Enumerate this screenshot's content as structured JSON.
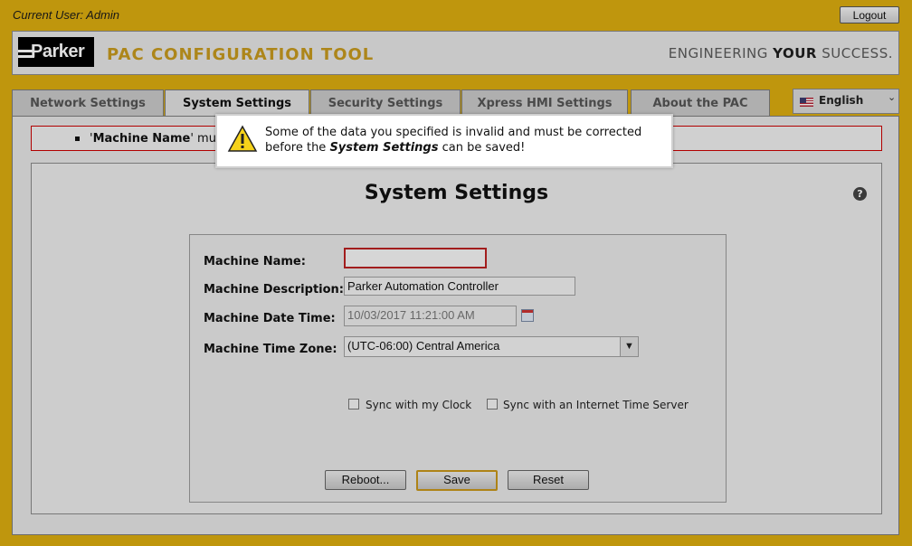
{
  "header": {
    "current_user": "Current User: Admin",
    "logout_label": "Logout",
    "app_title": "PAC CONFIGURATION TOOL",
    "logo_text": "Parker",
    "tagline_pre": "ENGINEERING ",
    "tagline_bold": "YOUR",
    "tagline_post": " SUCCESS."
  },
  "tabs": [
    {
      "label": "Network Settings",
      "active": false
    },
    {
      "label": "System Settings",
      "active": true
    },
    {
      "label": "Security Settings",
      "active": false
    },
    {
      "label": "Xpress HMI Settings",
      "active": false
    },
    {
      "label": "About the PAC",
      "active": false
    }
  ],
  "language": {
    "label": "English"
  },
  "error": {
    "field": "Machine Name",
    "text_after": "' must l"
  },
  "panel": {
    "title": "System Settings",
    "help": "?"
  },
  "form": {
    "machine_name_label": "Machine Name:",
    "machine_name_value": "",
    "machine_desc_label": "Machine Description:",
    "machine_desc_value": "Parker Automation Controller",
    "machine_datetime_label": "Machine Date Time:",
    "machine_datetime_value": "10/03/2017 11:21:00 AM",
    "machine_tz_label": "Machine Time Zone:",
    "machine_tz_value": "(UTC-06:00) Central America",
    "sync_clock_label": "Sync with my Clock",
    "sync_server_label": "Sync with an Internet Time Server"
  },
  "buttons": {
    "reboot": "Reboot...",
    "save": "Save",
    "reset": "Reset"
  },
  "modal": {
    "line1": "Some of the data you specified is invalid and must be corrected",
    "line2_pre": "before the ",
    "line2_bold": "System Settings",
    "line2_post": " can be saved!"
  },
  "colors": {
    "accent": "#dcad10",
    "title_gold": "#c79a1e",
    "error_red": "#cc0000"
  }
}
